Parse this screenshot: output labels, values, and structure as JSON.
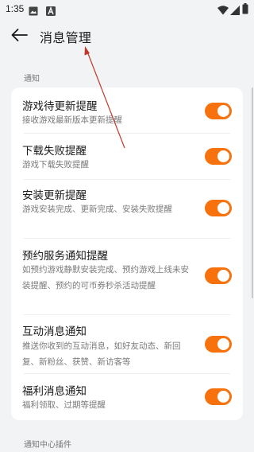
{
  "status_bar": {
    "time": "1:35",
    "icons": [
      "image-icon",
      "a-icon",
      "wifi-icon",
      "signal-icon",
      "battery-icon"
    ]
  },
  "header": {
    "title": "消息管理",
    "back_icon": "arrow-left-icon"
  },
  "sections": [
    {
      "label": "通知",
      "items": [
        {
          "title": "游戏待更新提醒",
          "desc": "接收游戏最新版本更新提醒",
          "enabled": true
        },
        {
          "title": "下载失败提醒",
          "desc": "游戏下载失败提醒",
          "enabled": true
        },
        {
          "title": "安装更新提醒",
          "desc": "游戏安装完成、更新完成、安装失败提醒",
          "enabled": true
        },
        {
          "title": "预约服务通知提醒",
          "desc": "如预约游戏静默安装完成、预约游戏上线未安装提醒、预约的可币券秒杀活动提醒",
          "enabled": true
        },
        {
          "title": "互动消息通知",
          "desc": "推送你收到的互动消息，如好友动态、新回复、新粉丝、获赞、新访客等",
          "enabled": true
        },
        {
          "title": "福利消息通知",
          "desc": "福利领取、过期等提醒",
          "enabled": true
        }
      ]
    },
    {
      "label": "通知中心插件"
    }
  ],
  "colors": {
    "accent": "#f7720d",
    "background": "#f1f3f5",
    "card": "#ffffff",
    "annotation_arrow": "#c0392b"
  }
}
